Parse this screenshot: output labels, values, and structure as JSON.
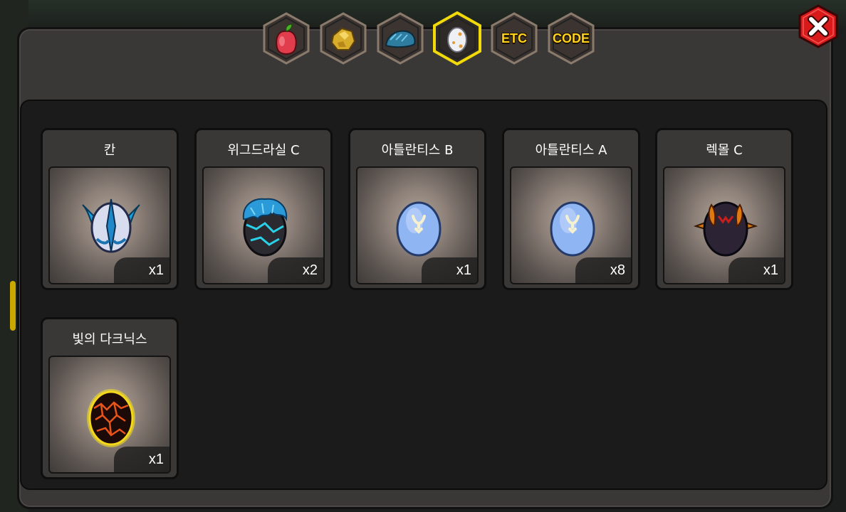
{
  "tabs": [
    {
      "id": "fruit",
      "icon": "fruit-icon",
      "label": ""
    },
    {
      "id": "gold",
      "icon": "gold-nugget-icon",
      "label": ""
    },
    {
      "id": "dragon",
      "icon": "dragon-icon",
      "label": ""
    },
    {
      "id": "egg",
      "icon": "egg-icon",
      "label": "",
      "active": true
    },
    {
      "id": "etc",
      "icon": "",
      "label": "ETC"
    },
    {
      "id": "code",
      "icon": "",
      "label": "CODE"
    }
  ],
  "close": {
    "icon": "close-icon"
  },
  "items": [
    {
      "name": "칸",
      "count": "x1",
      "egg": "kan-egg-icon"
    },
    {
      "name": "위그드라실 C",
      "count": "x2",
      "egg": "yggdrasil-egg-icon"
    },
    {
      "name": "아틀란티스 B",
      "count": "x1",
      "egg": "atlantis-b-egg-icon"
    },
    {
      "name": "아틀란티스 A",
      "count": "x8",
      "egg": "atlantis-a-egg-icon"
    },
    {
      "name": "렉몰 C",
      "count": "x1",
      "egg": "lekmol-egg-icon"
    },
    {
      "name": "빛의 다크닉스",
      "count": "x1",
      "egg": "darknix-egg-icon"
    }
  ],
  "colors": {
    "active_tab_border": "#f2d90a",
    "tab_text": "#ffd21a",
    "close_button": "#d81a1a"
  }
}
